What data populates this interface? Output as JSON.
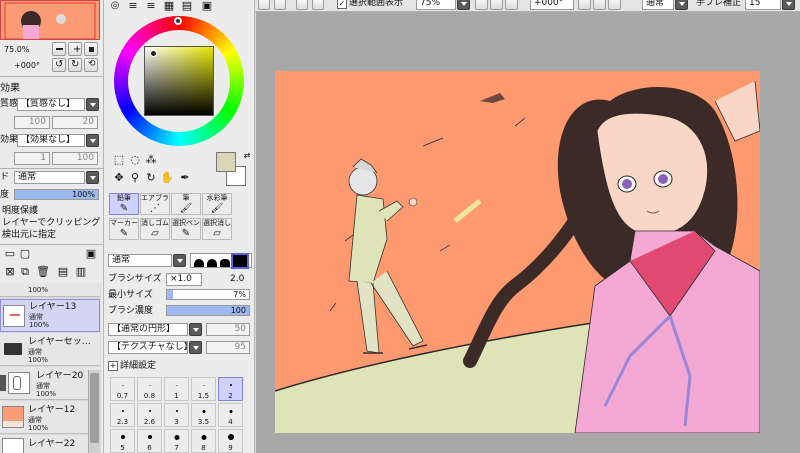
{
  "top_toolbar": {
    "selection_checkbox_label": "選択範囲表示",
    "zoom_value": "75%",
    "rotation_value": "+000°",
    "blend_mode": "通常",
    "stabilizer_label": "手ブレ補正",
    "stabilizer_value": "15"
  },
  "navigator": {
    "zoom_value": "75.0%",
    "rotation_value": "+000°"
  },
  "effects": {
    "title": "効果",
    "texture_label": "質感",
    "texture_value": "【質感なし】",
    "texture_scale": "100",
    "texture_strength": "20",
    "effect_label": "効果",
    "effect_value": "【効果なし】",
    "effect_width": "1",
    "effect_strength": "100"
  },
  "layer_settings": {
    "mode_label": "ド",
    "mode_value": "通常",
    "opacity_label": "度",
    "opacity_value": "100%",
    "options": [
      "明度保護",
      "レイヤーでクリッピング",
      "検出元に指定"
    ]
  },
  "layers": [
    {
      "name": "",
      "mode": "通常",
      "opacity": "100%",
      "thumb": "red"
    },
    {
      "name": "レイヤー13",
      "mode": "通常",
      "opacity": "100%",
      "thumb": "sketch",
      "selected": true
    },
    {
      "name": "レイヤーセッ…",
      "mode": "通常",
      "opacity": "100%",
      "thumb": "folder"
    },
    {
      "name": "レイヤー20",
      "mode": "通常",
      "opacity": "100%",
      "thumb": "figure"
    },
    {
      "name": "レイヤー12",
      "mode": "通常",
      "opacity": "100%",
      "thumb": "orange"
    },
    {
      "name": "レイヤー22",
      "mode": "",
      "opacity": "",
      "thumb": "white"
    }
  ],
  "tools": [
    {
      "label": "鉛筆",
      "icon": "✎",
      "selected": true
    },
    {
      "label": "エアブラシ",
      "icon": "⋰"
    },
    {
      "label": "筆",
      "icon": "🖌"
    },
    {
      "label": "水彩筆",
      "icon": "🖌"
    },
    {
      "label": "マーカー",
      "icon": "✎"
    },
    {
      "label": "消しゴム",
      "icon": "▱"
    },
    {
      "label": "選択ペン",
      "icon": "✎"
    },
    {
      "label": "選択消し",
      "icon": "▱"
    }
  ],
  "brush": {
    "blend_mode": "通常",
    "size_label": "ブラシサイズ",
    "size_multiplier": "×1.0",
    "size_value": "2.0",
    "min_size_label": "最小サイズ",
    "min_size_value": "7%",
    "density_label": "ブラシ濃度",
    "density_value": "100",
    "shape_value": "【通常の円形】",
    "shape_strength": "50",
    "texture_value": "【テクスチャなし】",
    "texture_strength": "95",
    "advanced_label": "詳細設定",
    "min_size_fill": 0.07,
    "density_fill": 1.0
  },
  "brush_sizes": [
    {
      "label": "0.7",
      "d": 1
    },
    {
      "label": "0.8",
      "d": 1
    },
    {
      "label": "1",
      "d": 1
    },
    {
      "label": "1.5",
      "d": 1
    },
    {
      "label": "2",
      "d": 2,
      "selected": true
    },
    {
      "label": "2.3",
      "d": 2
    },
    {
      "label": "2.6",
      "d": 2
    },
    {
      "label": "3",
      "d": 2
    },
    {
      "label": "3.5",
      "d": 3
    },
    {
      "label": "4",
      "d": 3
    },
    {
      "label": "5",
      "d": 4
    },
    {
      "label": "6",
      "d": 4
    },
    {
      "label": "7",
      "d": 5
    },
    {
      "label": "8",
      "d": 5
    },
    {
      "label": "9",
      "d": 6
    }
  ],
  "colors": {
    "primary": "#d9d7b8",
    "secondary": "#ffffff",
    "canvas_bg": "#ff9a70",
    "ground": "#dfe3b8",
    "skin": "#f9d6c6",
    "shirt": "#f4a8d4"
  }
}
